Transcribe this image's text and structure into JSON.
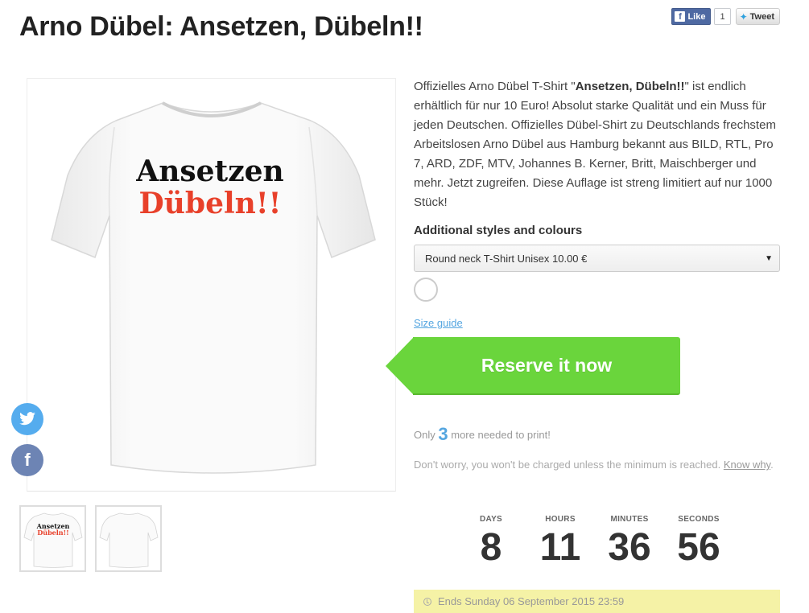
{
  "page": {
    "title": "Arno Dübel: Ansetzen, Dübeln!!"
  },
  "social_top": {
    "like_label": "Like",
    "like_count": "1",
    "tweet_label": "Tweet"
  },
  "product_image": {
    "line1": "Ansetzen",
    "line2": "Dübeln!!"
  },
  "description": {
    "pre": "Offizielles Arno Dübel T-Shirt \"",
    "bold": "Ansetzen, Dübeln!!",
    "post": "\" ist endlich erhältlich für nur 10 Euro! Absolut starke Qualität und ein Muss für jeden Deutschen. Offizielles Dübel-Shirt zu Deutschlands frechstem Arbeitslosen Arno Dübel aus Hamburg bekannt aus BILD, RTL, Pro 7, ARD, ZDF, MTV, Johannes B. Kerner, Britt, Maischberger und mehr. Jetzt zugreifen. Diese Auflage ist streng limitiert auf nur 1000 Stück!"
  },
  "styles": {
    "label": "Additional styles and colours",
    "selected": "Round neck T-Shirt Unisex 10.00 €",
    "swatch_color": "#ffffff"
  },
  "size_guide": "Size guide",
  "reserve": {
    "label": "Reserve it now",
    "color": "#6ad53c"
  },
  "progress": {
    "prefix": "Only",
    "count": "3",
    "suffix": "more needed to print!"
  },
  "notice": {
    "text": "Don't worry, you won't be charged unless the minimum is reached.",
    "link": "Know why",
    "end": "."
  },
  "countdown": [
    {
      "label": "DAYS",
      "value": "8"
    },
    {
      "label": "HOURS",
      "value": "11"
    },
    {
      "label": "MINUTES",
      "value": "36"
    },
    {
      "label": "SECONDS",
      "value": "56"
    }
  ],
  "ends": {
    "text": "Ends Sunday 06 September 2015 23:59"
  },
  "colors": {
    "accent": "#55a6e0",
    "shirt_red": "#e8402a",
    "ends_bg": "#f5f2a6"
  }
}
